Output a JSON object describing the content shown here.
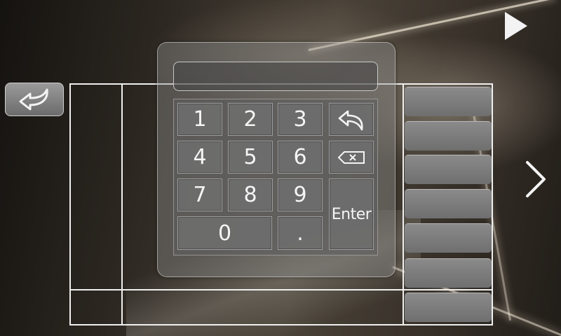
{
  "keypad": {
    "display_value": "",
    "keys": {
      "k1": "1",
      "k2": "2",
      "k3": "3",
      "k4": "4",
      "k5": "5",
      "k6": "6",
      "k7": "7",
      "k8": "8",
      "k9": "9",
      "k0": "0",
      "dot": ".",
      "enter": "Enter"
    },
    "icons": {
      "undo": "undo-arrow-icon",
      "backspace": "backspace-icon"
    }
  },
  "navigation": {
    "back_icon": "back-arrow-icon",
    "next_icon": "chevron-right-icon",
    "play_icon": "play-icon"
  },
  "side_buttons": {
    "count_visible": 7
  },
  "colors": {
    "frame_line": "#f0f0f0",
    "button_gray": "#7a7a7a",
    "text": "#f5f5f5"
  }
}
